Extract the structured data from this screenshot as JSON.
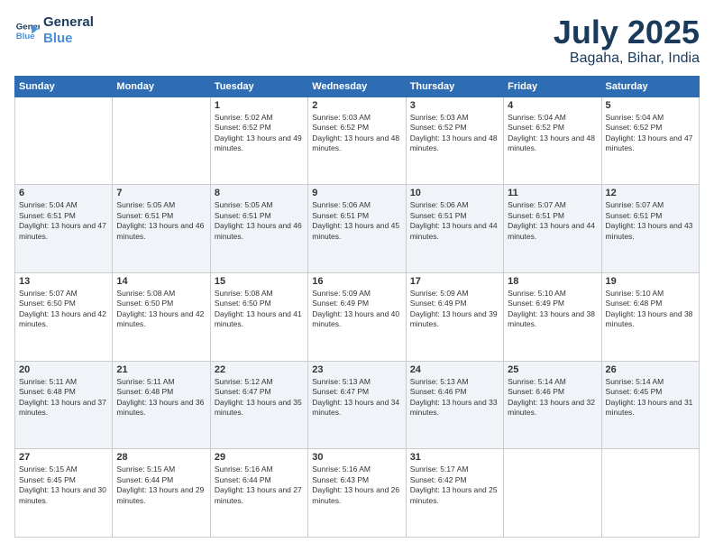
{
  "header": {
    "logo_line1": "General",
    "logo_line2": "Blue",
    "month": "July 2025",
    "location": "Bagaha, Bihar, India"
  },
  "weekdays": [
    "Sunday",
    "Monday",
    "Tuesday",
    "Wednesday",
    "Thursday",
    "Friday",
    "Saturday"
  ],
  "weeks": [
    [
      {
        "day": "",
        "detail": ""
      },
      {
        "day": "",
        "detail": ""
      },
      {
        "day": "1",
        "detail": "Sunrise: 5:02 AM\nSunset: 6:52 PM\nDaylight: 13 hours and 49 minutes."
      },
      {
        "day": "2",
        "detail": "Sunrise: 5:03 AM\nSunset: 6:52 PM\nDaylight: 13 hours and 48 minutes."
      },
      {
        "day": "3",
        "detail": "Sunrise: 5:03 AM\nSunset: 6:52 PM\nDaylight: 13 hours and 48 minutes."
      },
      {
        "day": "4",
        "detail": "Sunrise: 5:04 AM\nSunset: 6:52 PM\nDaylight: 13 hours and 48 minutes."
      },
      {
        "day": "5",
        "detail": "Sunrise: 5:04 AM\nSunset: 6:52 PM\nDaylight: 13 hours and 47 minutes."
      }
    ],
    [
      {
        "day": "6",
        "detail": "Sunrise: 5:04 AM\nSunset: 6:51 PM\nDaylight: 13 hours and 47 minutes."
      },
      {
        "day": "7",
        "detail": "Sunrise: 5:05 AM\nSunset: 6:51 PM\nDaylight: 13 hours and 46 minutes."
      },
      {
        "day": "8",
        "detail": "Sunrise: 5:05 AM\nSunset: 6:51 PM\nDaylight: 13 hours and 46 minutes."
      },
      {
        "day": "9",
        "detail": "Sunrise: 5:06 AM\nSunset: 6:51 PM\nDaylight: 13 hours and 45 minutes."
      },
      {
        "day": "10",
        "detail": "Sunrise: 5:06 AM\nSunset: 6:51 PM\nDaylight: 13 hours and 44 minutes."
      },
      {
        "day": "11",
        "detail": "Sunrise: 5:07 AM\nSunset: 6:51 PM\nDaylight: 13 hours and 44 minutes."
      },
      {
        "day": "12",
        "detail": "Sunrise: 5:07 AM\nSunset: 6:51 PM\nDaylight: 13 hours and 43 minutes."
      }
    ],
    [
      {
        "day": "13",
        "detail": "Sunrise: 5:07 AM\nSunset: 6:50 PM\nDaylight: 13 hours and 42 minutes."
      },
      {
        "day": "14",
        "detail": "Sunrise: 5:08 AM\nSunset: 6:50 PM\nDaylight: 13 hours and 42 minutes."
      },
      {
        "day": "15",
        "detail": "Sunrise: 5:08 AM\nSunset: 6:50 PM\nDaylight: 13 hours and 41 minutes."
      },
      {
        "day": "16",
        "detail": "Sunrise: 5:09 AM\nSunset: 6:49 PM\nDaylight: 13 hours and 40 minutes."
      },
      {
        "day": "17",
        "detail": "Sunrise: 5:09 AM\nSunset: 6:49 PM\nDaylight: 13 hours and 39 minutes."
      },
      {
        "day": "18",
        "detail": "Sunrise: 5:10 AM\nSunset: 6:49 PM\nDaylight: 13 hours and 38 minutes."
      },
      {
        "day": "19",
        "detail": "Sunrise: 5:10 AM\nSunset: 6:48 PM\nDaylight: 13 hours and 38 minutes."
      }
    ],
    [
      {
        "day": "20",
        "detail": "Sunrise: 5:11 AM\nSunset: 6:48 PM\nDaylight: 13 hours and 37 minutes."
      },
      {
        "day": "21",
        "detail": "Sunrise: 5:11 AM\nSunset: 6:48 PM\nDaylight: 13 hours and 36 minutes."
      },
      {
        "day": "22",
        "detail": "Sunrise: 5:12 AM\nSunset: 6:47 PM\nDaylight: 13 hours and 35 minutes."
      },
      {
        "day": "23",
        "detail": "Sunrise: 5:13 AM\nSunset: 6:47 PM\nDaylight: 13 hours and 34 minutes."
      },
      {
        "day": "24",
        "detail": "Sunrise: 5:13 AM\nSunset: 6:46 PM\nDaylight: 13 hours and 33 minutes."
      },
      {
        "day": "25",
        "detail": "Sunrise: 5:14 AM\nSunset: 6:46 PM\nDaylight: 13 hours and 32 minutes."
      },
      {
        "day": "26",
        "detail": "Sunrise: 5:14 AM\nSunset: 6:45 PM\nDaylight: 13 hours and 31 minutes."
      }
    ],
    [
      {
        "day": "27",
        "detail": "Sunrise: 5:15 AM\nSunset: 6:45 PM\nDaylight: 13 hours and 30 minutes."
      },
      {
        "day": "28",
        "detail": "Sunrise: 5:15 AM\nSunset: 6:44 PM\nDaylight: 13 hours and 29 minutes."
      },
      {
        "day": "29",
        "detail": "Sunrise: 5:16 AM\nSunset: 6:44 PM\nDaylight: 13 hours and 27 minutes."
      },
      {
        "day": "30",
        "detail": "Sunrise: 5:16 AM\nSunset: 6:43 PM\nDaylight: 13 hours and 26 minutes."
      },
      {
        "day": "31",
        "detail": "Sunrise: 5:17 AM\nSunset: 6:42 PM\nDaylight: 13 hours and 25 minutes."
      },
      {
        "day": "",
        "detail": ""
      },
      {
        "day": "",
        "detail": ""
      }
    ]
  ]
}
